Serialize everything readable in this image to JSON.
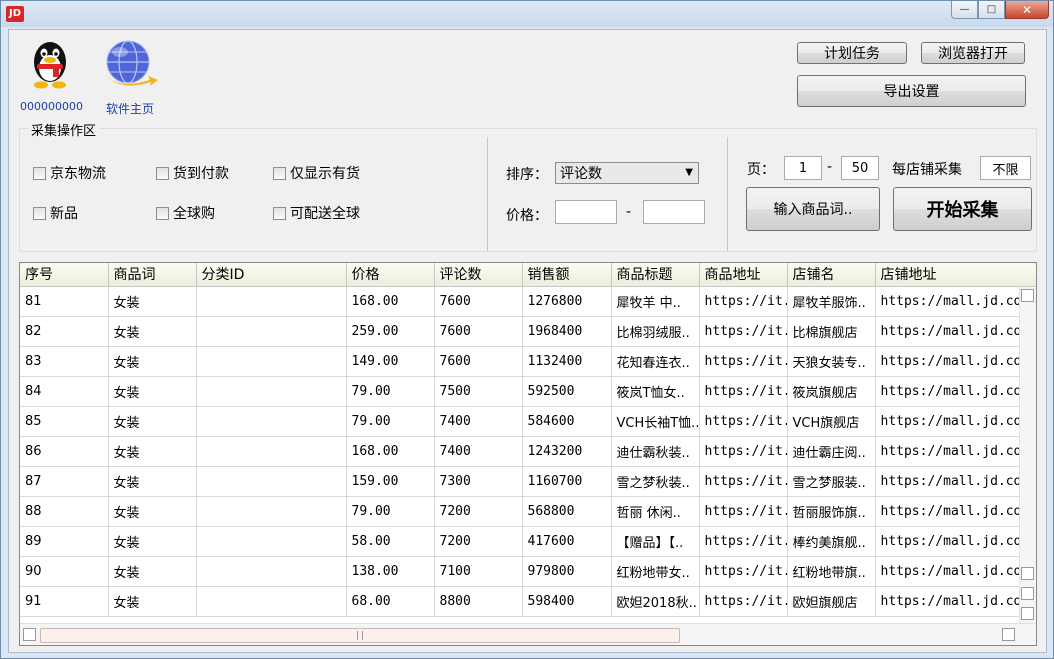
{
  "titlebar": {
    "app_icon_text": "JD",
    "minimize_icon": "minimize-icon",
    "maximize_icon": "maximize-icon",
    "close_icon": "close-icon"
  },
  "header": {
    "qq_number": "000000000",
    "home_label": "软件主页",
    "schedule_button": "计划任务",
    "browser_open_button": "浏览器打开",
    "export_settings_button": "导出设置"
  },
  "collect_area": {
    "title": "采集操作区",
    "checkboxes": [
      {
        "label": "京东物流",
        "checked": false
      },
      {
        "label": "货到付款",
        "checked": false
      },
      {
        "label": "仅显示有货",
        "checked": false
      },
      {
        "label": "新品",
        "checked": false
      },
      {
        "label": "全球购",
        "checked": false
      },
      {
        "label": "可配送全球",
        "checked": false
      }
    ],
    "sort_label": "排序：",
    "sort_value": "评论数",
    "price_label": "价格：",
    "price_dash": "-",
    "price_min": "",
    "price_max": "",
    "page_label": "页：",
    "page_from": "1",
    "page_dash": "-",
    "page_to": "50",
    "per_store_label": "每店铺采集",
    "per_store_value": "不限",
    "input_keyword_button": "输入商品词..",
    "start_button": "开始采集"
  },
  "table": {
    "columns": [
      "序号",
      "商品词",
      "分类ID",
      "价格",
      "评论数",
      "销售额",
      "商品标题",
      "商品地址",
      "店铺名",
      "店铺地址"
    ],
    "rows": [
      [
        "81",
        "女装",
        "",
        "168.00",
        "7600",
        "1276800",
        "犀牧羊 中..",
        "https://it..",
        "犀牧羊服饰..",
        "https://mall.jd.co"
      ],
      [
        "82",
        "女装",
        "",
        "259.00",
        "7600",
        "1968400",
        "比棉羽绒服..",
        "https://it..",
        "比棉旗舰店",
        "https://mall.jd.co"
      ],
      [
        "83",
        "女装",
        "",
        "149.00",
        "7600",
        "1132400",
        "花知春连衣..",
        "https://it..",
        "天狼女装专..",
        "https://mall.jd.co"
      ],
      [
        "84",
        "女装",
        "",
        "79.00",
        "7500",
        "592500",
        "筱岚T恤女..",
        "https://it..",
        "筱岚旗舰店",
        "https://mall.jd.co"
      ],
      [
        "85",
        "女装",
        "",
        "79.00",
        "7400",
        "584600",
        "VCH长袖T恤..",
        "https://it..",
        "VCH旗舰店",
        "https://mall.jd.co"
      ],
      [
        "86",
        "女装",
        "",
        "168.00",
        "7400",
        "1243200",
        "迪仕霸秋装..",
        "https://it..",
        "迪仕霸庄阅..",
        "https://mall.jd.co"
      ],
      [
        "87",
        "女装",
        "",
        "159.00",
        "7300",
        "1160700",
        "雪之梦秋装..",
        "https://it..",
        "雪之梦服装..",
        "https://mall.jd.co"
      ],
      [
        "88",
        "女装",
        "",
        "79.00",
        "7200",
        "568800",
        "哲丽 休闲..",
        "https://it..",
        "哲丽服饰旗..",
        "https://mall.jd.co"
      ],
      [
        "89",
        "女装",
        "",
        "58.00",
        "7200",
        "417600",
        "【赠品】【..",
        "https://it..",
        "棒约美旗舰..",
        "https://mall.jd.co"
      ],
      [
        "90",
        "女装",
        "",
        "138.00",
        "7100",
        "979800",
        "红粉地带女..",
        "https://it..",
        "红粉地带旗..",
        "https://mall.jd.co"
      ],
      [
        "91",
        "女装",
        "",
        "68.00",
        "8800",
        "598400",
        "欧妲2018秋..",
        "https://it..",
        "欧妲旗舰店",
        "https://mall.jd.co"
      ]
    ]
  }
}
